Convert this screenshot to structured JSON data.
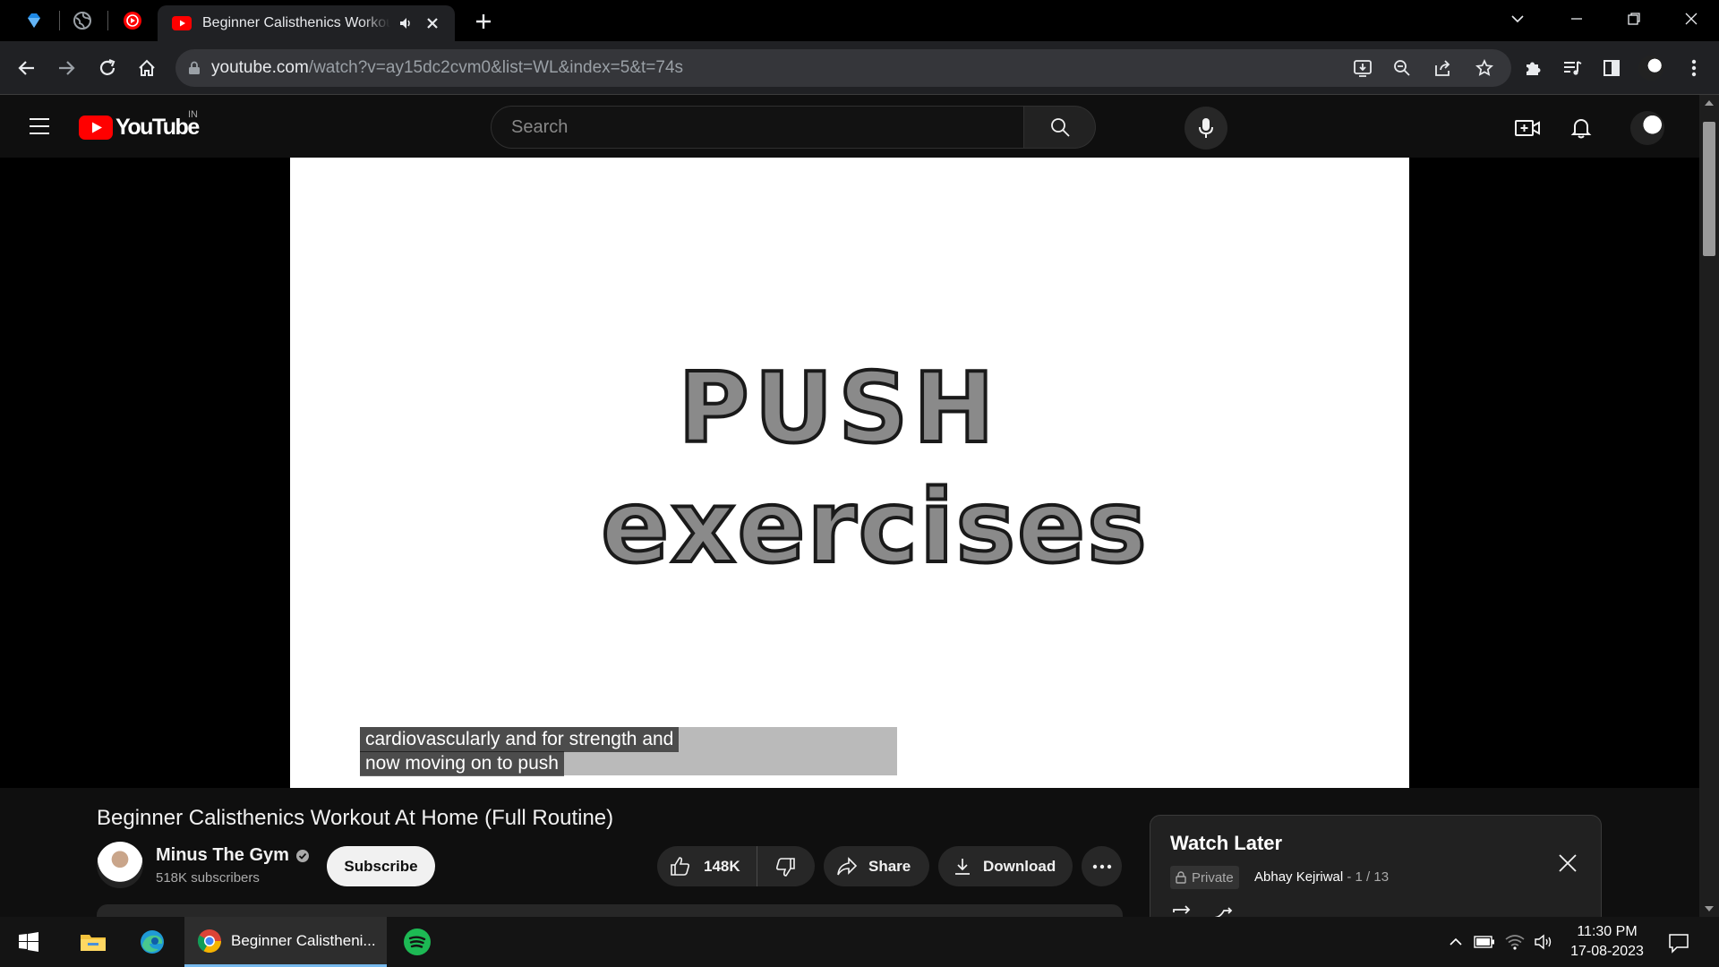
{
  "browser": {
    "tab_title": "Beginner Calisthenics Workout At Home (Full Routine)",
    "url_host": "youtube.com",
    "url_path": "/watch?v=ay15dc2cvm0&list=WL&index=5&t=74s"
  },
  "masthead": {
    "logo_text": "YouTube",
    "country_code": "IN",
    "search_placeholder": "Search"
  },
  "video": {
    "frame_line1": "PUSH",
    "frame_line2": "exercises",
    "caption_line1": "cardiovascularly and for strength and",
    "caption_line2": "now moving on to push"
  },
  "details": {
    "title": "Beginner Calisthenics Workout At Home (Full Routine)",
    "channel_name": "Minus The Gym",
    "subscribers": "518K subscribers",
    "subscribe_label": "Subscribe",
    "like_count": "148K",
    "share_label": "Share",
    "download_label": "Download"
  },
  "playlist": {
    "title": "Watch Later",
    "privacy": "Private",
    "owner": "Abhay Kejriwal",
    "position": " - 1 / 13"
  },
  "taskbar": {
    "chrome_label": "Beginner Calistheni...",
    "time": "11:30 PM",
    "date": "17-08-2023"
  },
  "colors": {
    "youtube_red": "#ff0000",
    "background": "#0f0f0f",
    "chip_bg": "#272727"
  }
}
